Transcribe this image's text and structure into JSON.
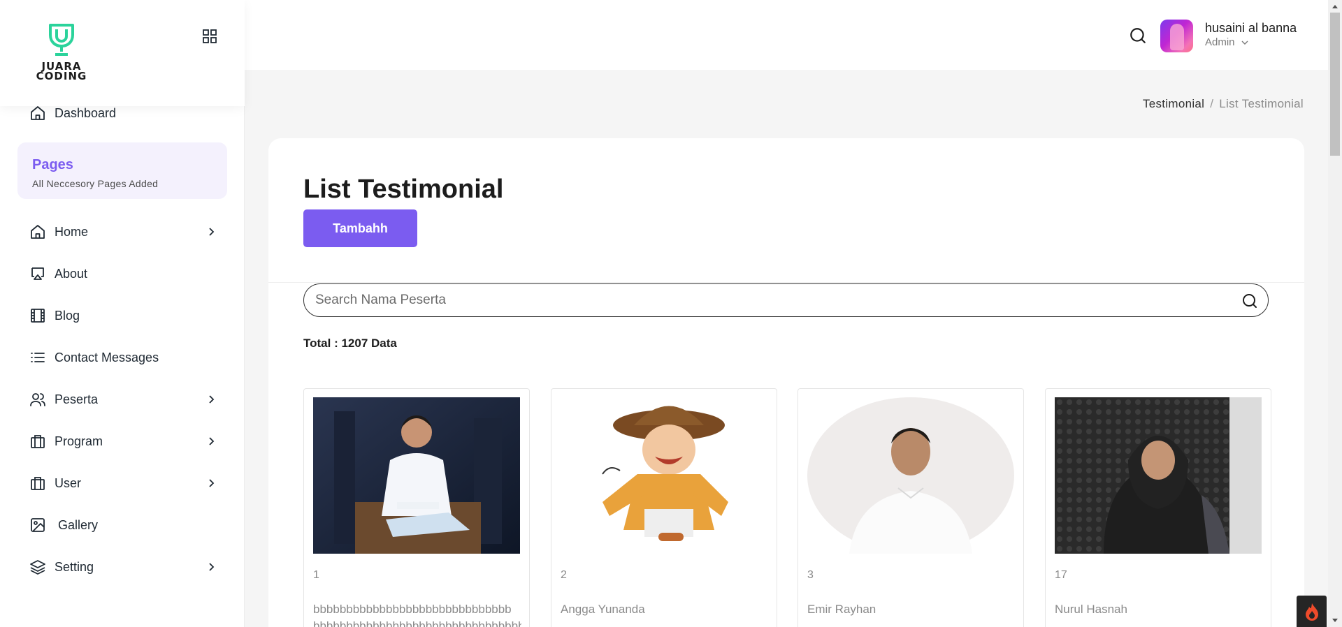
{
  "brand": {
    "logo_line1": "JUARA",
    "logo_line2": "CODING",
    "accent": "#2bd39b"
  },
  "sidebar": {
    "dashboard_label": "Dashboard",
    "pages_title": "Pages",
    "pages_subtitle": "All Neccesory Pages Added",
    "items": [
      {
        "label": "Home",
        "icon": "home-icon",
        "has_submenu": true
      },
      {
        "label": "About",
        "icon": "monitor-icon",
        "has_submenu": false
      },
      {
        "label": "Blog",
        "icon": "film-icon",
        "has_submenu": false
      },
      {
        "label": "Contact Messages",
        "icon": "list-icon",
        "has_submenu": false
      },
      {
        "label": "Peserta",
        "icon": "users-icon",
        "has_submenu": true
      },
      {
        "label": "Program",
        "icon": "briefcase-icon",
        "has_submenu": true
      },
      {
        "label": "User",
        "icon": "briefcase-icon",
        "has_submenu": true
      },
      {
        "label": "Gallery",
        "icon": "image-icon",
        "has_submenu": false
      },
      {
        "label": "Setting",
        "icon": "layers-icon",
        "has_submenu": true
      }
    ]
  },
  "header": {
    "user_name": "husaini al banna",
    "user_role": "Admin"
  },
  "breadcrumb": {
    "parent": "Testimonial",
    "separator": "/",
    "current": "List Testimonial"
  },
  "main": {
    "title": "List Testimonial",
    "add_label": "Tambahh",
    "search_placeholder": "Search Nama Peserta",
    "total_text": "Total : 1207 Data",
    "accent": "#7b5cf0"
  },
  "items": [
    {
      "number": "1",
      "name": "bbbbbbbbbbbbbbbbbbbbbbbbbbbbbb",
      "name_overflow": "bbbbbbbbbbbbbbbbbbbbbbbbbbbbbbbb",
      "image": "man-seated-stage-photo"
    },
    {
      "number": "2",
      "name": "Angga Yunanda",
      "image": "cowboy-cartoon-sticker"
    },
    {
      "number": "3",
      "name": "Emir Rayhan",
      "image": "man-white-shirt-oval-photo"
    },
    {
      "number": "17",
      "name": "Nurul Hasnah",
      "image": "woman-hijab-photo"
    }
  ]
}
